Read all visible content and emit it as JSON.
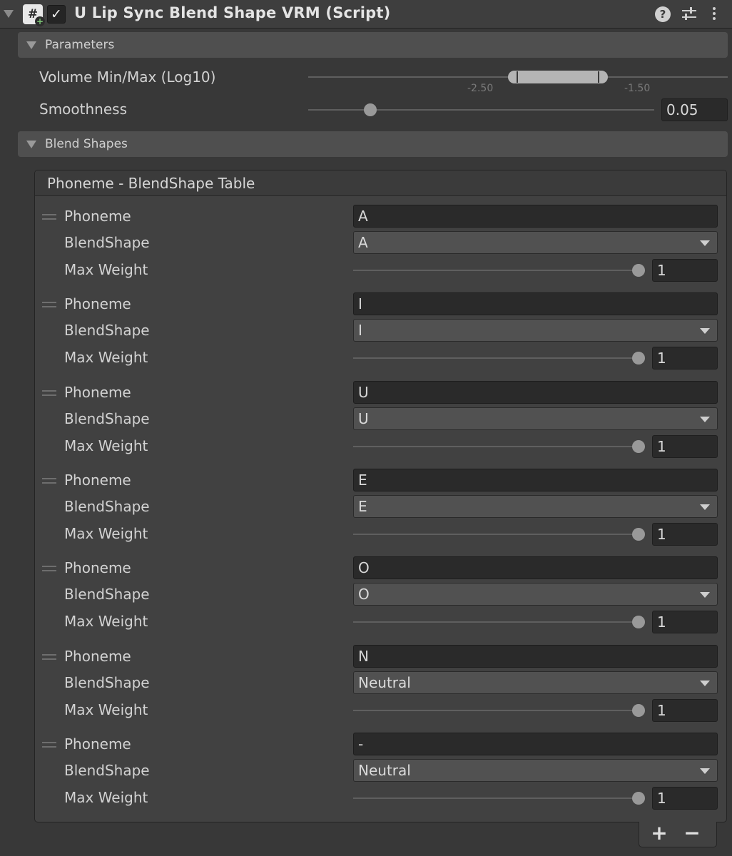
{
  "component": {
    "title": "U Lip Sync Blend Shape VRM (Script)",
    "enabled": true,
    "icons": [
      "script-icon",
      "help-icon",
      "settings-icon",
      "more-icon"
    ]
  },
  "parameters": {
    "section_label": "Parameters",
    "volume": {
      "label": "Volume Min/Max (Log10)",
      "min_value": -2.5,
      "max_value": -1.5,
      "min_text": "-2.50",
      "max_text": "-1.50"
    },
    "smoothness": {
      "label": "Smoothness",
      "value": "0.05"
    }
  },
  "blend_shapes": {
    "section_label": "Blend Shapes",
    "table_title": "Phoneme - BlendShape Table",
    "labels": {
      "phoneme": "Phoneme",
      "blendshape": "BlendShape",
      "max_weight": "Max Weight"
    },
    "entries": [
      {
        "phoneme": "A",
        "blendshape": "A",
        "max_weight": "1"
      },
      {
        "phoneme": "I",
        "blendshape": "I",
        "max_weight": "1"
      },
      {
        "phoneme": "U",
        "blendshape": "U",
        "max_weight": "1"
      },
      {
        "phoneme": "E",
        "blendshape": "E",
        "max_weight": "1"
      },
      {
        "phoneme": "O",
        "blendshape": "O",
        "max_weight": "1"
      },
      {
        "phoneme": "N",
        "blendshape": "Neutral",
        "max_weight": "1"
      },
      {
        "phoneme": "-",
        "blendshape": "Neutral",
        "max_weight": "1"
      }
    ],
    "add_label": "+",
    "remove_label": "−"
  }
}
